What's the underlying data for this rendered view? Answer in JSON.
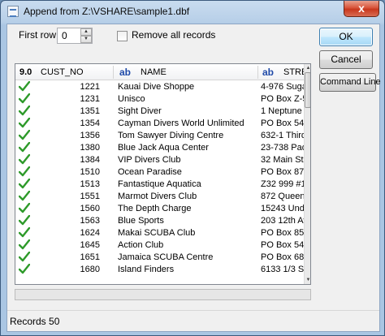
{
  "window": {
    "title": "Append from Z:\\VSHARE\\sample1.dbf",
    "close_symbol": "x"
  },
  "options": {
    "first_row_label": "First row",
    "first_row_value": "0",
    "remove_all_label": "Remove all records",
    "remove_all_checked": false
  },
  "buttons": {
    "ok": "OK",
    "cancel": "Cancel",
    "command_line": "Command Line"
  },
  "grid": {
    "columns": [
      {
        "type_badge": "9.0",
        "label": "CUST_NO"
      },
      {
        "type_badge": "ab",
        "label": "NAME"
      },
      {
        "type_badge": "ab",
        "label": "STRE"
      }
    ],
    "check_icon": "check-icon",
    "rows": [
      {
        "cust_no": "1221",
        "name": "Kauai Dive Shoppe",
        "street": "4-976 Suga"
      },
      {
        "cust_no": "1231",
        "name": "Unisco",
        "street": "PO Box Z-5"
      },
      {
        "cust_no": "1351",
        "name": "Sight Diver",
        "street": "1 Neptune L"
      },
      {
        "cust_no": "1354",
        "name": "Cayman Divers World Unlimited",
        "street": "PO Box 541"
      },
      {
        "cust_no": "1356",
        "name": "Tom Sawyer Diving Centre",
        "street": "632-1 Third"
      },
      {
        "cust_no": "1380",
        "name": "Blue Jack Aqua Center",
        "street": "23-738 Pad"
      },
      {
        "cust_no": "1384",
        "name": "VIP Divers Club",
        "street": "32 Main St."
      },
      {
        "cust_no": "1510",
        "name": "Ocean Paradise",
        "street": "PO Box 874"
      },
      {
        "cust_no": "1513",
        "name": "Fantastique Aquatica",
        "street": "Z32 999 #1"
      },
      {
        "cust_no": "1551",
        "name": "Marmot Divers Club",
        "street": "872 Queen"
      },
      {
        "cust_no": "1560",
        "name": "The Depth Charge",
        "street": "15243 Unde"
      },
      {
        "cust_no": "1563",
        "name": "Blue Sports",
        "street": "203 12th Av"
      },
      {
        "cust_no": "1624",
        "name": "Makai SCUBA Club",
        "street": "PO Box 853"
      },
      {
        "cust_no": "1645",
        "name": "Action Club",
        "street": "PO Box 545"
      },
      {
        "cust_no": "1651",
        "name": "Jamaica SCUBA Centre",
        "street": "PO Box 68"
      },
      {
        "cust_no": "1680",
        "name": "Island Finders",
        "street": "6133 1/3 St"
      }
    ]
  },
  "status": {
    "records": "Records 50"
  }
}
